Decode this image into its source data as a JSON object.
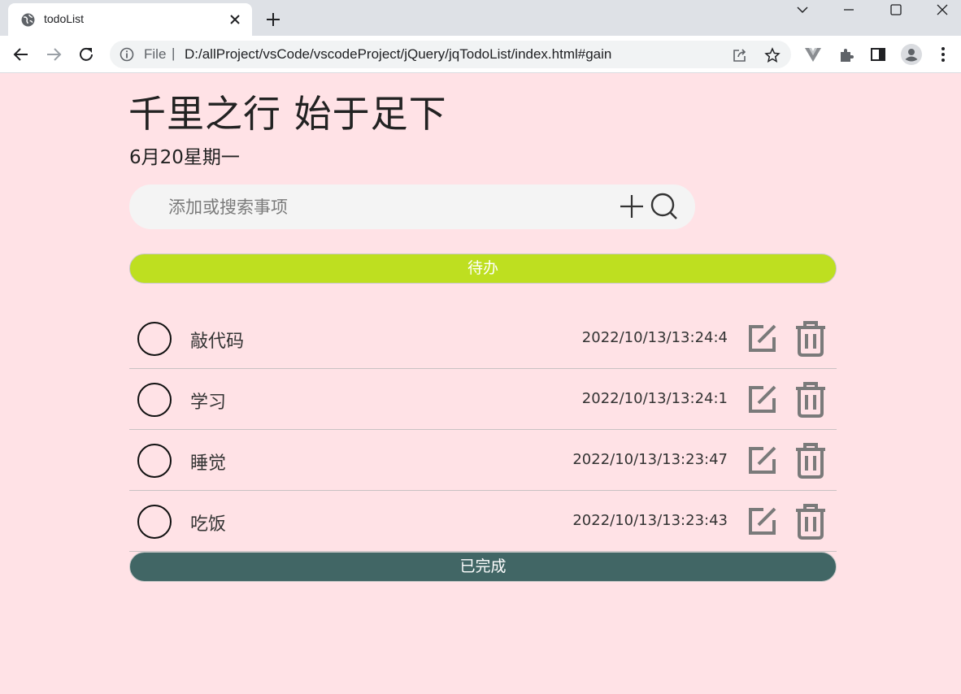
{
  "browser": {
    "tab_title": "todoList",
    "url_scheme": "File",
    "url_separator": "|",
    "url": "D:/allProject/vsCode/vscodeProject/jQuery/jqTodoList/index.html#gain"
  },
  "page": {
    "title": "千里之行 始于足下",
    "date": "6月20星期一"
  },
  "search": {
    "placeholder": "添加或搜索事项"
  },
  "sections": {
    "todo_label": "待办",
    "done_label": "已完成"
  },
  "todos": [
    {
      "text": "敲代码",
      "time": "2022/10/13/13:24:4"
    },
    {
      "text": "学习",
      "time": "2022/10/13/13:24:1"
    },
    {
      "text": "睡觉",
      "time": "2022/10/13/13:23:47"
    },
    {
      "text": "吃饭",
      "time": "2022/10/13/13:23:43"
    }
  ],
  "colors": {
    "page_bg": "#ffe2e6",
    "todo_bar": "#bedf20",
    "done_bar": "#416665",
    "icon_gray": "#7a7a7a"
  },
  "icons": {
    "add": "plus-icon",
    "search": "search-icon",
    "edit": "edit-icon",
    "delete": "trash-icon",
    "check": "circle-checkbox"
  }
}
